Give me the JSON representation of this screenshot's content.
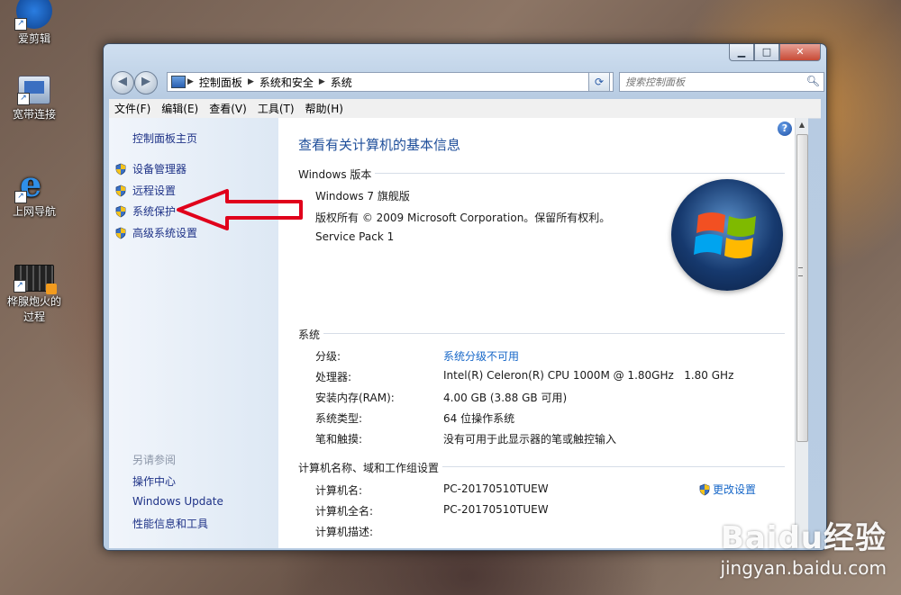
{
  "desktop": {
    "icons": [
      {
        "label": "爱剪辑",
        "icon": "video-editor-icon"
      },
      {
        "label": "宽带连接",
        "icon": "network-connection-icon"
      },
      {
        "label": "上网导航",
        "icon": "internet-explorer-icon"
      },
      {
        "label": "桦腺炮火的",
        "label2": "过程",
        "icon": "video-file-icon"
      }
    ]
  },
  "window": {
    "caption_buttons": {
      "minimize": "▁",
      "maximize": "□",
      "close": "✕"
    },
    "nav": {
      "back": "◀",
      "forward": "▶"
    },
    "breadcrumb": [
      "控制面板",
      "系统和安全",
      "系统"
    ],
    "search_placeholder": "搜索控制面板",
    "menu": [
      "文件(F)",
      "编辑(E)",
      "查看(V)",
      "工具(T)",
      "帮助(H)"
    ]
  },
  "left_pane": {
    "home": "控制面板主页",
    "tasks": [
      "设备管理器",
      "远程设置",
      "系统保护",
      "高级系统设置"
    ],
    "see_also_title": "另请参阅",
    "see_also": [
      "操作中心",
      "Windows Update",
      "性能信息和工具"
    ]
  },
  "main": {
    "title": "查看有关计算机的基本信息",
    "help": "?",
    "edition": {
      "header": "Windows 版本",
      "name": "Windows 7 旗舰版",
      "copyright": "版权所有 © 2009 Microsoft Corporation。保留所有权利。",
      "service_pack": "Service Pack 1"
    },
    "system": {
      "header": "系统",
      "rows": [
        {
          "label": "分级:",
          "value": "系统分级不可用",
          "is_link": true
        },
        {
          "label": "处理器:",
          "value": "Intel(R) Celeron(R) CPU 1000M @ 1.80GHz   1.80 GHz"
        },
        {
          "label": "安装内存(RAM):",
          "value": "4.00 GB (3.88 GB 可用)"
        },
        {
          "label": "系统类型:",
          "value": "64 位操作系统"
        },
        {
          "label": "笔和触摸:",
          "value": "没有可用于此显示器的笔或触控输入"
        }
      ]
    },
    "computer": {
      "header": "计算机名称、域和工作组设置",
      "change_settings": "更改设置",
      "rows": [
        {
          "label": "计算机名:",
          "value": "PC-20170510TUEW"
        },
        {
          "label": "计算机全名:",
          "value": "PC-20170510TUEW"
        },
        {
          "label": "计算机描述:",
          "value": ""
        }
      ]
    }
  },
  "watermark": {
    "brand": "Baidu经验",
    "url": "jingyan.baidu.com"
  },
  "colors": {
    "accent_link": "#1767c8",
    "nav_link": "#1e3287",
    "annotation_arrow": "#e0001b"
  }
}
